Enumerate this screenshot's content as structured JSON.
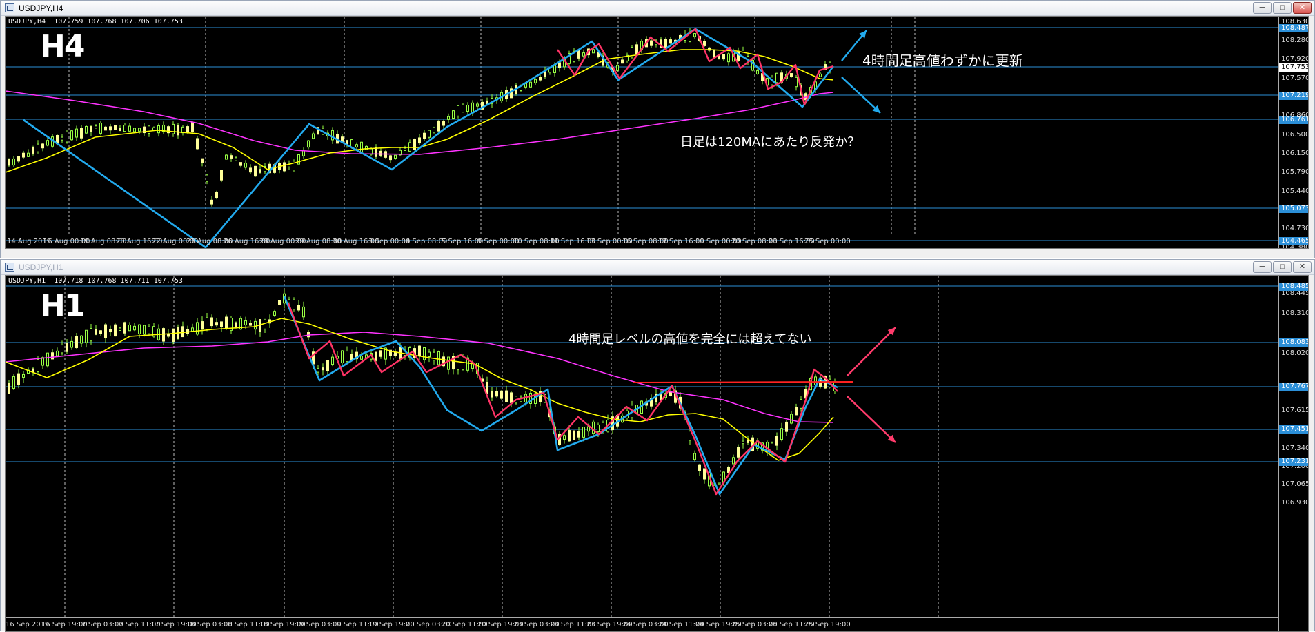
{
  "windows": [
    {
      "title": "USDJPY,H4",
      "symbol_info": "USDJPY,H4  107.759 107.768 107.706 107.753",
      "label": "H4",
      "annotations": [
        "4時間足高値わずかに更新",
        "日足は120MAにあたり反発か？"
      ],
      "x_labels": [
        "14 Aug 2019",
        "16 Aug 00:00",
        "19 Aug 08:00",
        "20 Aug 16:00",
        "22 Aug 00:00",
        "23 Aug 08:00",
        "26 Aug 16:00",
        "28 Aug 00:00",
        "29 Aug 08:00",
        "30 Aug 16:00",
        "3 Sep 00:00",
        "4 Sep 08:00",
        "5 Sep 16:00",
        "9 Sep 00:00",
        "10 Sep 08:00",
        "11 Sep 16:00",
        "13 Sep 00:00",
        "16 Sep 08:00",
        "17 Sep 16:00",
        "19 Sep 00:00",
        "20 Sep 08:00",
        "23 Sep 16:00",
        "25 Sep 00:00"
      ],
      "y_labels": [
        "108.630",
        "108.280",
        "107.920",
        "107.570",
        "106.860",
        "106.500",
        "106.150",
        "105.790",
        "105.440",
        "104.730",
        "104.380"
      ],
      "y_badges": [
        {
          "text": "108.487",
          "style": "blue"
        },
        {
          "text": "107.753",
          "style": "white"
        },
        {
          "text": "107.219",
          "style": "blue"
        },
        {
          "text": "106.761",
          "style": "blue"
        },
        {
          "text": "105.073",
          "style": "blue"
        },
        {
          "text": "104.465",
          "style": "blue"
        }
      ]
    },
    {
      "title": "USDJPY,H1",
      "symbol_info": "USDJPY,H1  107.718 107.768 107.711 107.753",
      "label": "H1",
      "annotations": [
        "4時間足レベルの高値を完全には超えてない"
      ],
      "x_labels": [
        "16 Sep 2019",
        "16 Sep 19:00",
        "17 Sep 03:00",
        "17 Sep 11:00",
        "17 Sep 19:00",
        "18 Sep 03:00",
        "18 Sep 11:00",
        "18 Sep 19:00",
        "19 Sep 03:00",
        "19 Sep 11:00",
        "19 Sep 19:00",
        "20 Sep 03:00",
        "20 Sep 11:00",
        "20 Sep 19:00",
        "23 Sep 03:00",
        "23 Sep 11:00",
        "23 Sep 19:00",
        "24 Sep 03:00",
        "24 Sep 11:00",
        "24 Sep 19:00",
        "25 Sep 03:00",
        "25 Sep 11:00",
        "25 Sep 19:00"
      ],
      "y_labels": [
        "108.445",
        "108.310",
        "108.020",
        "107.615",
        "107.340",
        "107.200",
        "107.065",
        "106.930"
      ],
      "y_badges": [
        {
          "text": "108.485",
          "style": "blue"
        },
        {
          "text": "108.083",
          "style": "blue"
        },
        {
          "text": "107.767",
          "style": "blue"
        },
        {
          "text": "107.451",
          "style": "blue"
        },
        {
          "text": "107.231",
          "style": "blue"
        }
      ]
    }
  ],
  "icons": {
    "window_icon": "chart-window-icon",
    "minimize": "minimize-icon",
    "maximize": "maximize-icon",
    "close": "close-icon"
  },
  "colors": {
    "background": "#000000",
    "bull_candle": "#ffff99",
    "bear_candle": "#99ff44",
    "ma_short": "#ffff00",
    "ma_long": "#ff33ff",
    "zigzag_blue": "#22aaee",
    "zigzag_red": "#ff3366",
    "level_line": "#2b8fd8",
    "resistance": "#ff2222"
  }
}
